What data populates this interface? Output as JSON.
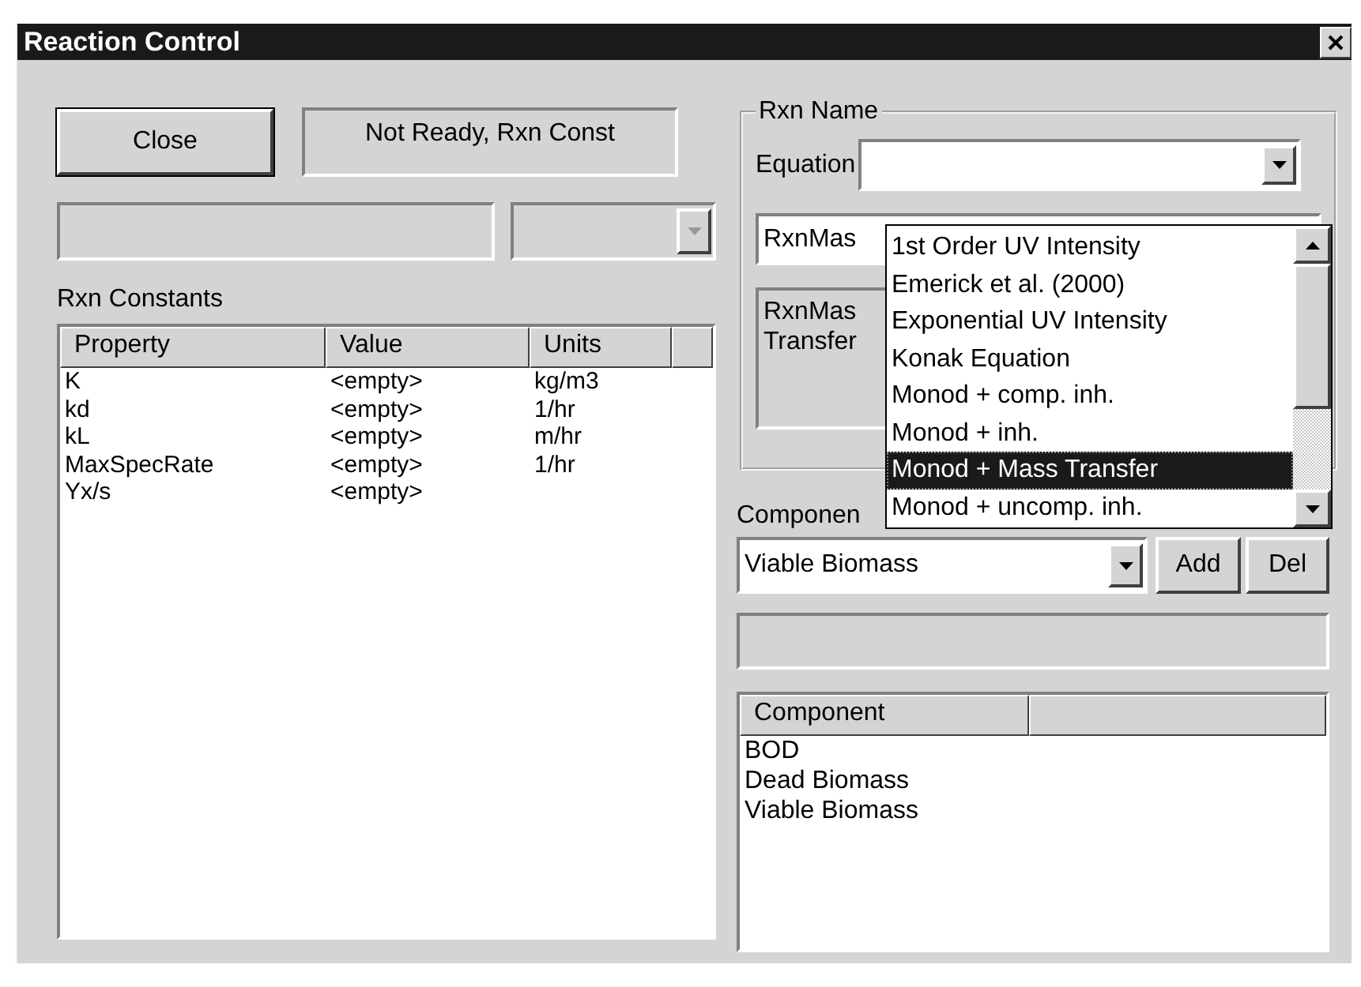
{
  "window": {
    "title": "Reaction Control"
  },
  "close_button": "Close",
  "status": "Not Ready, Rxn Const",
  "left_combo": {
    "disabled": true
  },
  "constants_label": "Rxn Constants",
  "constants_table": {
    "columns": [
      "Property",
      "Value",
      "Units"
    ],
    "rows": [
      [
        "K",
        "<empty>",
        "kg/m3"
      ],
      [
        "kd",
        "<empty>",
        "1/hr"
      ],
      [
        "kL",
        "<empty>",
        "m/hr"
      ],
      [
        "MaxSpecRate",
        "<empty>",
        "1/hr"
      ],
      [
        "Yx/s",
        "<empty>",
        ""
      ]
    ]
  },
  "rxn_group": {
    "title": "Rxn Name",
    "equation_label": "Equation",
    "name_field": "RxnMas",
    "description": [
      "RxnMas",
      "Transfer"
    ]
  },
  "equation_dropdown": {
    "items": [
      {
        "label": "1st Order UV Intensity",
        "selected": false
      },
      {
        "label": "Emerick et al. (2000)",
        "selected": false
      },
      {
        "label": "Exponential UV Intensity",
        "selected": false
      },
      {
        "label": "Konak Equation",
        "selected": false
      },
      {
        "label": "Monod + comp. inh.",
        "selected": false
      },
      {
        "label": "Monod + inh.",
        "selected": false
      },
      {
        "label": "Monod + Mass Transfer",
        "selected": true
      },
      {
        "label": "Monod + uncomp. inh.",
        "selected": false
      }
    ]
  },
  "component_label": "Componen",
  "component_combo": {
    "value": "Viable Biomass"
  },
  "add_button": "Add",
  "del_button": "Del",
  "components_table": {
    "columns": [
      "Component"
    ],
    "rows": [
      "BOD",
      "Dead Biomass",
      "Viable Biomass"
    ]
  }
}
